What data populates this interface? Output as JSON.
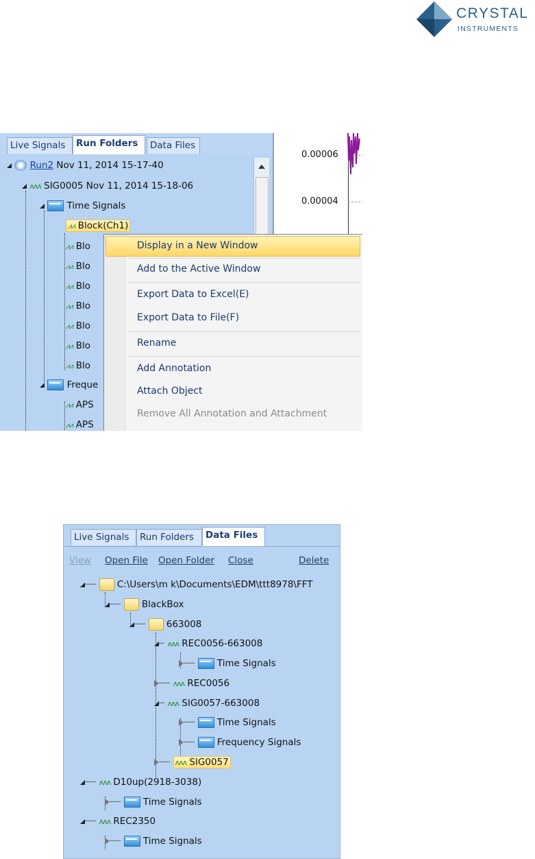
{
  "logo": {
    "line1": "CRYSTAL",
    "line2": "INSTRUMENTS"
  },
  "shot1": {
    "tabs": [
      "Live Signals",
      "Run Folders",
      "Data Files"
    ],
    "active_tab": "Run Folders",
    "plot_ticks": [
      "0.00006",
      "0.00004"
    ],
    "tree": {
      "run": {
        "name": "Run2",
        "date": "Nov 11, 2014 15-17-40"
      },
      "sig": {
        "name": "SIG0005",
        "date": "Nov 11, 2014 15-18-06"
      },
      "time_signals": "Time Signals",
      "blocks": [
        "Block(Ch1)",
        "Blo",
        "Blo",
        "Blo",
        "Blo",
        "Blo",
        "Blo",
        "Blo"
      ],
      "frequency": "Freque",
      "aps": [
        "APS",
        "APS"
      ]
    },
    "context_menu": [
      {
        "label": "Display in a New Window",
        "highlighted": true
      },
      {
        "label": "Add to the Active Window"
      },
      {
        "label": "Export Data to Excel(E)"
      },
      {
        "label": "Export Data to File(F)"
      },
      {
        "label": "Rename"
      },
      {
        "label": "Add Annotation"
      },
      {
        "label": "Attach Object"
      },
      {
        "label": "Remove All Annotation and Attachment",
        "disabled": true
      }
    ]
  },
  "shot2": {
    "tabs": [
      "Live Signals",
      "Run Folders",
      "Data Files"
    ],
    "active_tab": "Data Files",
    "toolbar": {
      "view": "View",
      "open_file": "Open File",
      "open_folder": "Open Folder",
      "close": "Close",
      "delete": "Delete"
    },
    "tree": {
      "root": "C:\\Users\\m k\\Documents\\EDM\\ttt8978\\FFT",
      "blackbox": "BlackBox",
      "folder": "663008",
      "rec0056_663008": "REC0056-663008",
      "time_signals": "Time Signals",
      "rec0056": "REC0056",
      "sig0057_663008": "SIG0057-663008",
      "frequency_signals": "Frequency Signals",
      "sig0057": "SIG0057",
      "d10up": "D10up(2918-3038)",
      "rec2350": "REC2350"
    }
  },
  "colors": {
    "panel": "#b8d4f2",
    "accent": "#2a5f8a",
    "highlight": "#ffe07a",
    "wave": "#1d8a1d",
    "plot_trace": "#8a1a9a"
  }
}
